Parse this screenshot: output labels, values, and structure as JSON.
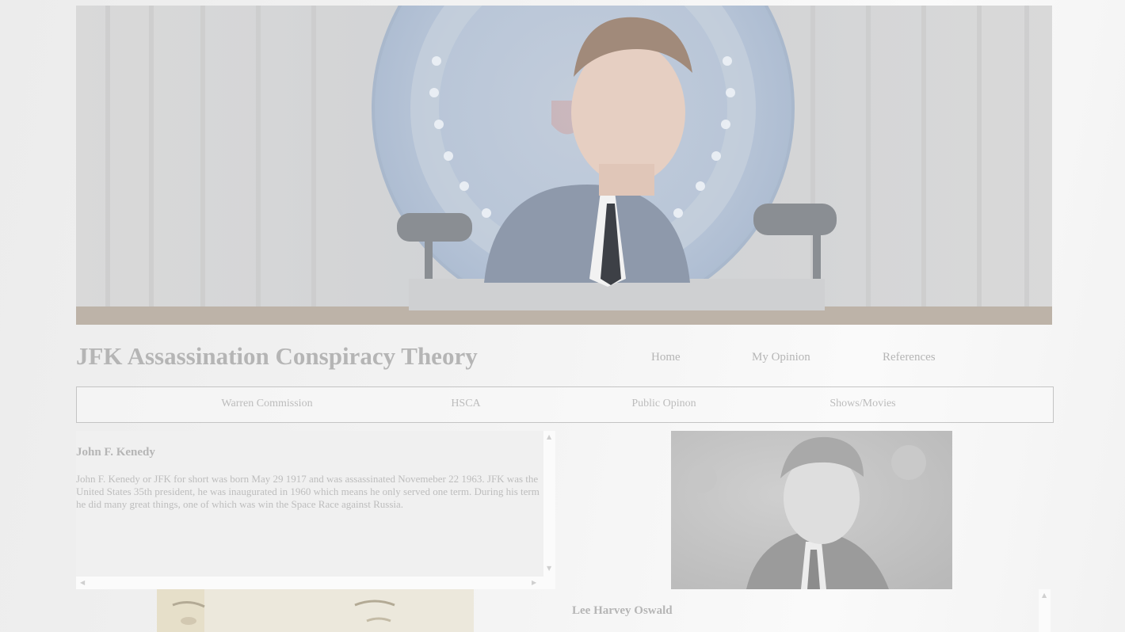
{
  "site": {
    "title": "JFK Assassination Conspiracy Theory"
  },
  "top_nav": [
    {
      "label": "Home"
    },
    {
      "label": "My Opinion"
    },
    {
      "label": "References"
    }
  ],
  "sub_nav": [
    {
      "label": "Warren Commission"
    },
    {
      "label": "HSCA"
    },
    {
      "label": "Public Opinon"
    },
    {
      "label": "Shows/Movies"
    }
  ],
  "sections": [
    {
      "heading": "John F. Kenedy",
      "body": "John F. Kenedy or JFK for short was born May 29 1917 and was assassinated Novemeber 22 1963. JFK was the United States 35th president, he was inaugurated in 1960 which means he only served one term. During his term he did many great things, one of which was win the Space Race against Russia."
    },
    {
      "heading": "Lee Harvey Oswald",
      "body": ""
    }
  ],
  "icons": {
    "scroll_up": "▲",
    "scroll_down": "▼",
    "scroll_left": "◀",
    "scroll_right": "▶"
  },
  "colors": {
    "text_muted": "#b5b5b5",
    "border": "#c4c4c4",
    "panel_bg": "#f0f0f0"
  }
}
